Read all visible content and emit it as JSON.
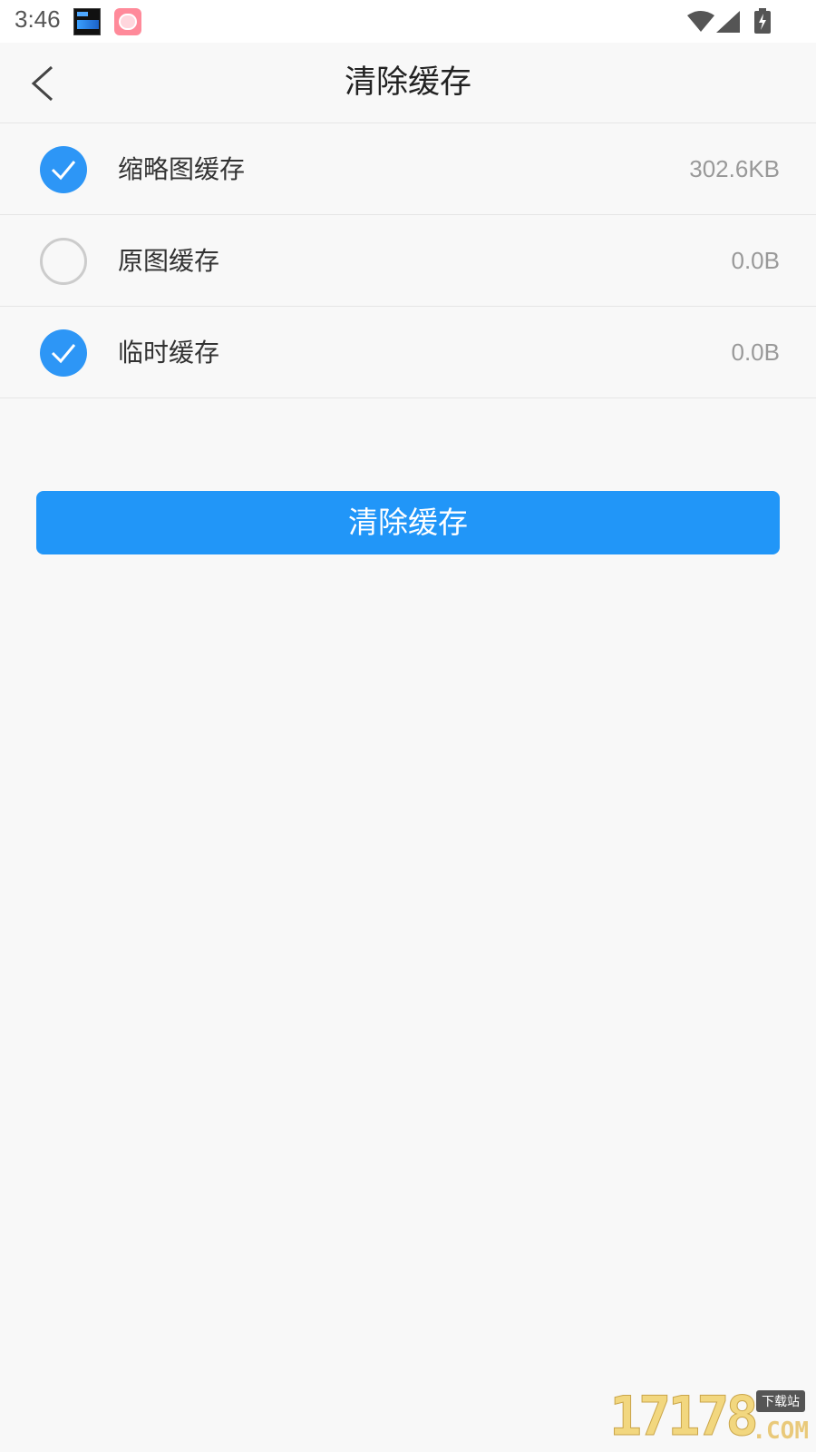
{
  "status_bar": {
    "time": "3:46"
  },
  "header": {
    "back_icon": "chevron-left-icon",
    "title": "清除缓存"
  },
  "cache_items": [
    {
      "label": "缩略图缓存",
      "size": "302.6KB",
      "checked": true
    },
    {
      "label": "原图缓存",
      "size": "0.0B",
      "checked": false
    },
    {
      "label": "临时缓存",
      "size": "0.0B",
      "checked": true
    }
  ],
  "actions": {
    "clear_label": "清除缓存"
  },
  "colors": {
    "accent": "#2196f8",
    "check_on": "#2d96f6",
    "check_off_border": "#cccccc",
    "background": "#f8f8f8"
  },
  "watermark": {
    "digits": "17178",
    "site": "下载站",
    "suffix": ".COM"
  }
}
